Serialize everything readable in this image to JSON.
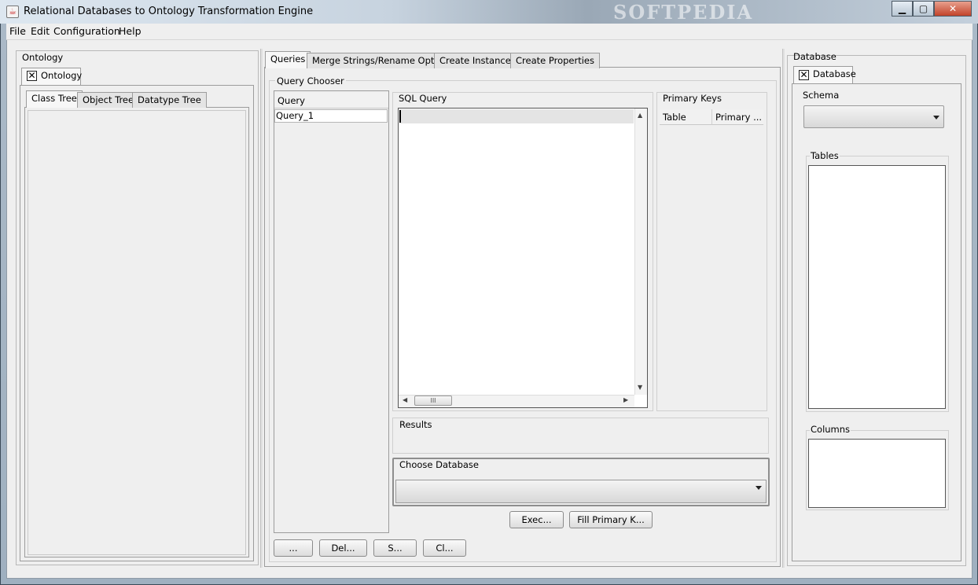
{
  "window": {
    "title": "Relational Databases to Ontology Transformation Engine",
    "watermark": "SOFTPEDIA",
    "minimize": "▁",
    "maximize": "▢",
    "close": "✕"
  },
  "menu": [
    "File",
    "Edit",
    "Configuration",
    "Help"
  ],
  "ontology_panel": {
    "title": "Ontology",
    "tab": "Ontology",
    "tabs": [
      "Class Tree",
      "Object Tree",
      "Datatype Tree"
    ]
  },
  "main_tabs": [
    "Queries",
    "Merge Strings/Rename Options",
    "Create Instances",
    "Create Properties"
  ],
  "query_chooser": {
    "title": "Query Chooser",
    "column": "Query",
    "rows": [
      "Query_1"
    ],
    "buttons": [
      "...",
      "Del...",
      "S...",
      "Cl..."
    ]
  },
  "sql_query": {
    "title": "SQL Query"
  },
  "primary_keys": {
    "title": "Primary Keys",
    "columns": [
      "Table",
      "Primary ..."
    ]
  },
  "results": {
    "title": "Results"
  },
  "choose_database": {
    "title": "Choose Database"
  },
  "action_buttons": [
    "Exec...",
    "Fill Primary K..."
  ],
  "database_panel": {
    "title": "Database",
    "tab": "Database",
    "schema_label": "Schema",
    "tables_label": "Tables",
    "columns_label": "Columns"
  },
  "scrollbar": {
    "thumb_glyph": "III"
  }
}
